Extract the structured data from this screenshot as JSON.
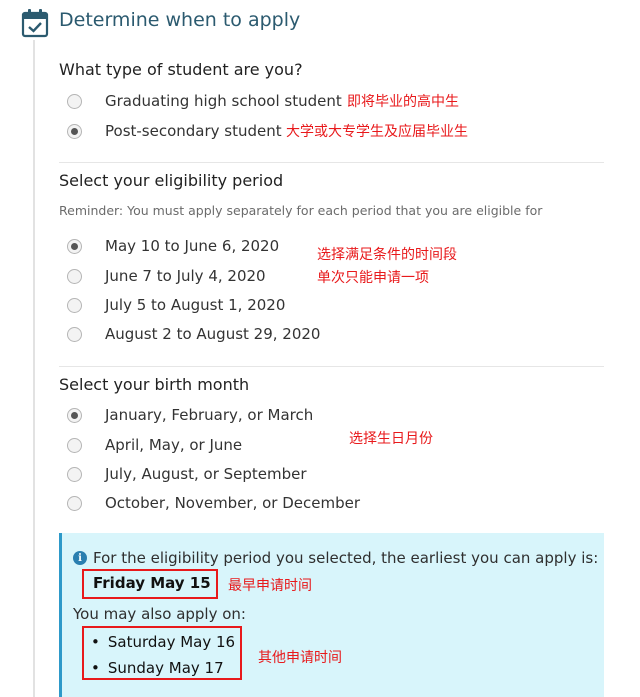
{
  "header": {
    "title": "Determine when to apply",
    "icon": "calendar-check-icon"
  },
  "student_type": {
    "question": "What type of student are you?",
    "options": [
      {
        "label": "Graduating high school student",
        "selected": false,
        "annotation": "即将毕业的高中生"
      },
      {
        "label": "Post-secondary student",
        "selected": true,
        "annotation": "大学或大专学生及应届毕业生"
      }
    ]
  },
  "eligibility": {
    "question": "Select your eligibility period",
    "reminder": "Reminder: You must apply separately for each period that you are eligible for",
    "options": [
      {
        "label": "May 10 to June 6, 2020",
        "selected": true
      },
      {
        "label": "June 7 to July 4, 2020",
        "selected": false
      },
      {
        "label": "July 5 to August 1, 2020",
        "selected": false
      },
      {
        "label": "August 2 to August 29, 2020",
        "selected": false
      }
    ],
    "annotation_1": "选择满足条件的时间段",
    "annotation_2": "单次只能申请一项"
  },
  "birth_month": {
    "question": "Select your birth month",
    "options": [
      {
        "label": "January, February, or March",
        "selected": true
      },
      {
        "label": "April, May, or June",
        "selected": false
      },
      {
        "label": "July, August, or September",
        "selected": false
      },
      {
        "label": "October, November, or December",
        "selected": false
      }
    ],
    "annotation": "选择生日月份"
  },
  "info": {
    "message": "For the eligibility period you selected, the earliest you can apply is:",
    "earliest": "Friday May 15",
    "earliest_annotation": "最早申请时间",
    "also_label": "You may also apply on:",
    "also_dates": [
      "Saturday May 16",
      "Sunday May 17"
    ],
    "also_annotation": "其他申请时间"
  },
  "colors": {
    "title": "#2b5a6f",
    "annotation": "#e8191b",
    "info_bg": "#d8f5fb",
    "info_accent": "#2d99c9"
  }
}
